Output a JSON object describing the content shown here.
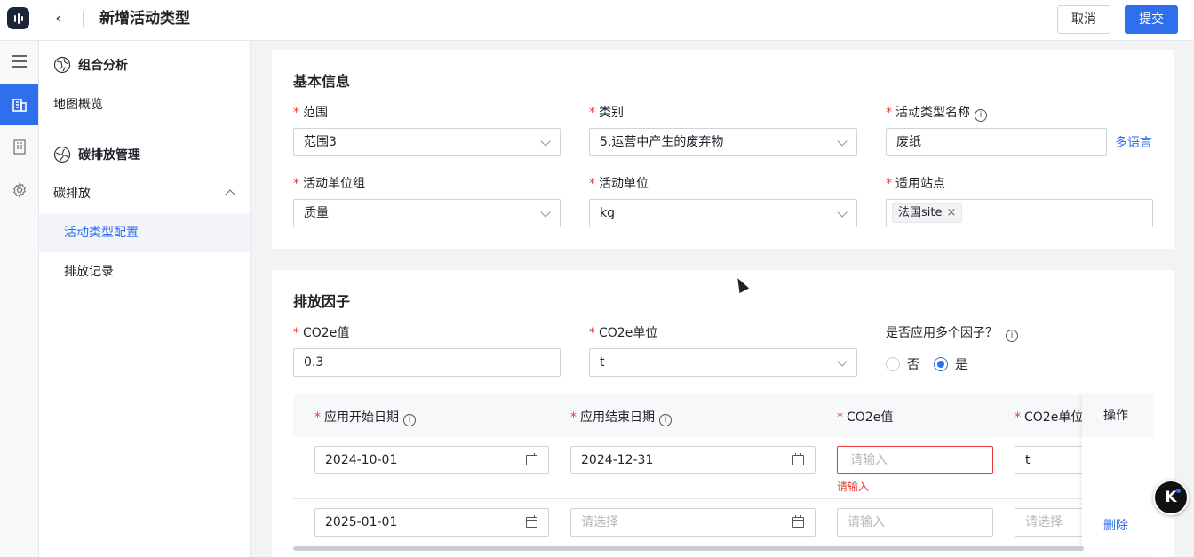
{
  "header": {
    "title": "新增活动类型",
    "cancel_label": "取消",
    "submit_label": "提交"
  },
  "rail": {
    "icons": [
      "menu-icon",
      "building-icon",
      "office-icon",
      "settings-icon"
    ]
  },
  "sidebar": {
    "group1": {
      "label": "组合分析",
      "items": [
        "地图概览"
      ]
    },
    "group2": {
      "label": "碳排放管理",
      "submenu": "碳排放",
      "items": [
        "活动类型配置",
        "排放记录"
      ]
    }
  },
  "basic": {
    "title": "基本信息",
    "scope": {
      "label": "范围",
      "value": "范围3"
    },
    "category": {
      "label": "类别",
      "value": "5.运营中产生的废弃物"
    },
    "type_name": {
      "label": "活动类型名称",
      "value": "废纸",
      "multilang": "多语言"
    },
    "unit_group": {
      "label": "活动单位组",
      "value": "质量"
    },
    "unit": {
      "label": "活动单位",
      "value": "kg"
    },
    "sites": {
      "label": "适用站点",
      "tag": "法国site"
    }
  },
  "factor": {
    "title": "排放因子",
    "co2e_value": {
      "label": "CO2e值",
      "value": "0.3"
    },
    "co2e_unit": {
      "label": "CO2e单位",
      "value": "t"
    },
    "multi": {
      "label": "是否应用多个因子？",
      "no": "否",
      "yes": "是",
      "selected": "是"
    },
    "table": {
      "headers": [
        "应用开始日期",
        "应用结束日期",
        "CO2e值",
        "CO2e单位",
        "操作"
      ],
      "rows": [
        {
          "start": "2024-10-01",
          "end": "2024-12-31",
          "co2e_placeholder": "请输入",
          "unit": "t",
          "error": "请输入",
          "action": ""
        },
        {
          "start": "2025-01-01",
          "end_placeholder": "请选择",
          "co2e_placeholder": "请输入",
          "unit_placeholder": "请选择",
          "action": "删除"
        }
      ]
    }
  }
}
